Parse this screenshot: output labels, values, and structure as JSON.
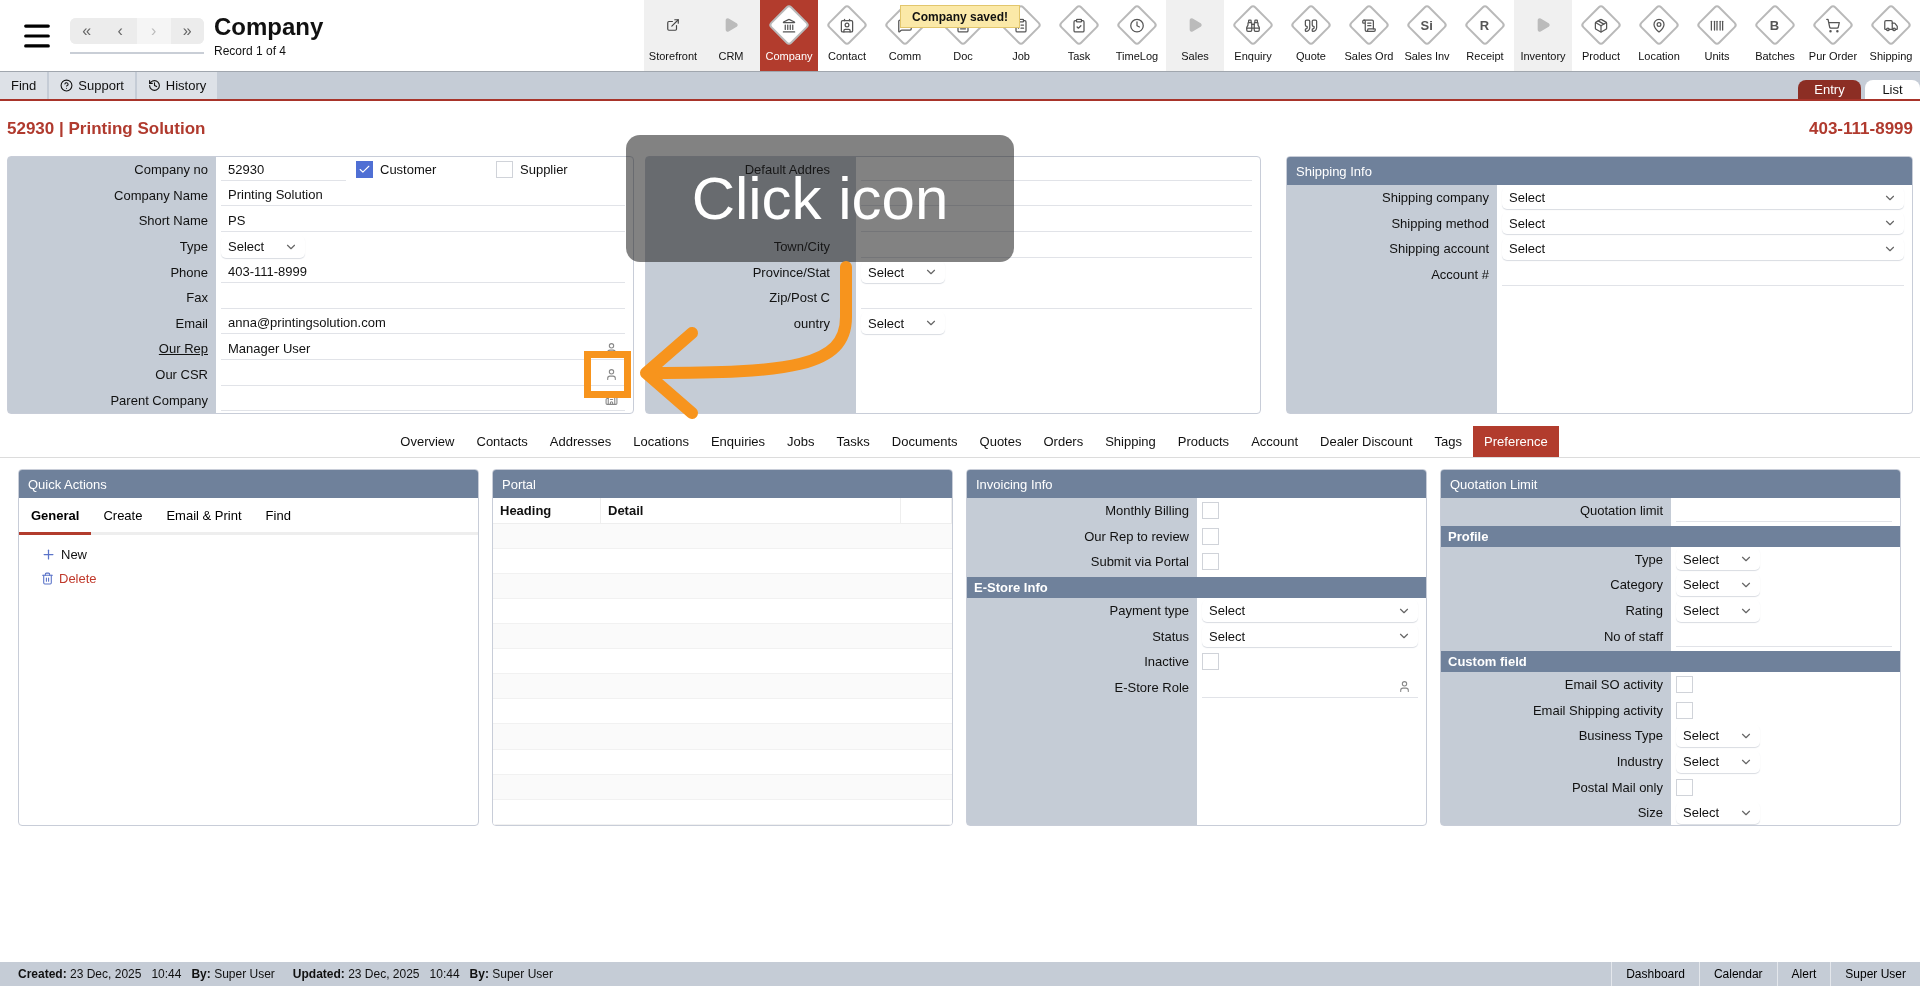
{
  "topbar": {
    "title": "Company",
    "record": "Record 1 of 4",
    "nav": [
      {
        "label": "«",
        "disabled": false
      },
      {
        "label": "‹",
        "disabled": false
      },
      {
        "label": "›",
        "disabled": true
      },
      {
        "label": "»",
        "disabled": false
      }
    ],
    "modules": [
      {
        "label": "Storefront",
        "kind": "link",
        "selected": false
      },
      {
        "label": "CRM",
        "kind": "group",
        "selected": false
      },
      {
        "label": "Company",
        "kind": "module",
        "selected": true
      },
      {
        "label": "Contact",
        "kind": "module",
        "selected": false
      },
      {
        "label": "Comm",
        "kind": "module",
        "selected": false
      },
      {
        "label": "Doc",
        "kind": "module",
        "selected": false
      },
      {
        "label": "Job",
        "kind": "module",
        "selected": false
      },
      {
        "label": "Task",
        "kind": "module",
        "selected": false
      },
      {
        "label": "TimeLog",
        "kind": "module",
        "selected": false
      },
      {
        "label": "Sales",
        "kind": "group",
        "selected": false
      },
      {
        "label": "Enquiry",
        "kind": "module",
        "selected": false
      },
      {
        "label": "Quote",
        "kind": "module",
        "selected": false
      },
      {
        "label": "Sales Ord",
        "kind": "module",
        "selected": false
      },
      {
        "label": "Sales Inv",
        "kind": "module",
        "selected": false,
        "glyph": "Si"
      },
      {
        "label": "Receipt",
        "kind": "module",
        "selected": false,
        "glyph": "R"
      },
      {
        "label": "Inventory",
        "kind": "group",
        "selected": false
      },
      {
        "label": "Product",
        "kind": "module",
        "selected": false
      },
      {
        "label": "Location",
        "kind": "module",
        "selected": false
      },
      {
        "label": "Units",
        "kind": "module",
        "selected": false
      },
      {
        "label": "Batches",
        "kind": "module",
        "selected": false,
        "glyph": "B"
      },
      {
        "label": "Pur Order",
        "kind": "module",
        "selected": false
      },
      {
        "label": "Shipping",
        "kind": "module",
        "selected": false
      }
    ]
  },
  "toast": "Company saved!",
  "toolbar": {
    "buttons": [
      {
        "label": "Find",
        "kind": "plain"
      },
      {
        "label": "Support",
        "kind": "help"
      },
      {
        "label": "History",
        "kind": "history"
      }
    ],
    "views": [
      {
        "label": "Entry",
        "selected": true
      },
      {
        "label": "List",
        "selected": false
      }
    ]
  },
  "record": {
    "heading": "52930 | Printing Solution",
    "phone": "403-111-8999"
  },
  "company_panel": {
    "rows": [
      {
        "label": "Company no",
        "kind": "text",
        "value": "52930",
        "flags": [
          {
            "label": "Customer",
            "checked": true
          },
          {
            "label": "Supplier",
            "checked": false
          }
        ]
      },
      {
        "label": "Company Name",
        "kind": "text",
        "value": "Printing Solution"
      },
      {
        "label": "Short Name",
        "kind": "text",
        "value": "PS"
      },
      {
        "label": "Type",
        "kind": "choice",
        "value": "Select"
      },
      {
        "label": "Phone",
        "kind": "text",
        "value": "403-111-8999"
      },
      {
        "label": "Fax",
        "kind": "text"
      },
      {
        "label": "Email",
        "kind": "text",
        "value": "anna@printingsolution.com"
      },
      {
        "label": "Our Rep",
        "kind": "lookup",
        "value": "Manager User",
        "link": true
      },
      {
        "label": "Our CSR",
        "kind": "lookup"
      },
      {
        "label": "Parent Company",
        "kind": "company"
      }
    ]
  },
  "address_panel": {
    "rows": [
      {
        "label": "Default Addres",
        "kind": "text"
      },
      {
        "kind": "text"
      },
      {
        "kind": "text"
      },
      {
        "label": "Town/City",
        "kind": "text"
      },
      {
        "label": "Province/Stat",
        "kind": "choice",
        "value": "Select"
      },
      {
        "label": "Zip/Post C",
        "kind": "text"
      },
      {
        "label": "ountry",
        "kind": "choice",
        "value": "Select"
      }
    ]
  },
  "shipping_panel": {
    "title": "Shipping Info",
    "rows": [
      {
        "label": "Shipping company",
        "kind": "select",
        "value": "Select"
      },
      {
        "label": "Shipping method",
        "kind": "select",
        "value": "Select"
      },
      {
        "label": "Shipping account",
        "kind": "select",
        "value": "Select"
      },
      {
        "label": "Account #",
        "kind": "text"
      }
    ]
  },
  "tabs": [
    {
      "label": "Overview",
      "selected": false
    },
    {
      "label": "Contacts",
      "selected": false
    },
    {
      "label": "Addresses",
      "selected": false
    },
    {
      "label": "Locations",
      "selected": false
    },
    {
      "label": "Enquiries",
      "selected": false
    },
    {
      "label": "Jobs",
      "selected": false
    },
    {
      "label": "Tasks",
      "selected": false
    },
    {
      "label": "Documents",
      "selected": false
    },
    {
      "label": "Quotes",
      "selected": false
    },
    {
      "label": "Orders",
      "selected": false
    },
    {
      "label": "Shipping",
      "selected": false
    },
    {
      "label": "Products",
      "selected": false
    },
    {
      "label": "Account",
      "selected": false
    },
    {
      "label": "Dealer Discount",
      "selected": false
    },
    {
      "label": "Tags",
      "selected": false
    },
    {
      "label": "Preference",
      "selected": true
    }
  ],
  "quick_actions": {
    "title": "Quick Actions",
    "tabs": [
      {
        "label": "General",
        "selected": true
      },
      {
        "label": "Create",
        "selected": false
      },
      {
        "label": "Email & Print",
        "selected": false
      },
      {
        "label": "Find",
        "selected": false
      }
    ],
    "actions": [
      {
        "label": "New",
        "kind": "add"
      },
      {
        "label": "Delete",
        "kind": "delete"
      }
    ]
  },
  "portal": {
    "title": "Portal",
    "columns": [
      "Heading",
      "Detail"
    ]
  },
  "invoicing": {
    "title": "Invoicing Info",
    "sections": [
      {
        "rows": [
          {
            "label": "Monthly Billing",
            "kind": "checkbox",
            "checked": false
          },
          {
            "label": "Our Rep to review",
            "kind": "checkbox",
            "checked": false
          },
          {
            "label": "Submit via Portal",
            "kind": "checkbox",
            "checked": false
          }
        ]
      },
      {
        "title": "E-Store Info",
        "rows": [
          {
            "label": "Payment type",
            "kind": "select",
            "value": "Select"
          },
          {
            "label": "Status",
            "kind": "select",
            "value": "Select"
          },
          {
            "label": "Inactive",
            "kind": "checkbox",
            "checked": false
          },
          {
            "label": "E-Store Role",
            "kind": "lookup"
          }
        ]
      }
    ]
  },
  "quotation": {
    "title": "Quotation Limit",
    "sections": [
      {
        "rows": [
          {
            "label": "Quotation limit",
            "kind": "text"
          }
        ]
      },
      {
        "title": "Profile",
        "rows": [
          {
            "label": "Type",
            "kind": "choice",
            "value": "Select"
          },
          {
            "label": "Category",
            "kind": "choice",
            "value": "Select"
          },
          {
            "label": "Rating",
            "kind": "choice",
            "value": "Select"
          },
          {
            "label": "No of staff",
            "kind": "text"
          }
        ]
      },
      {
        "title": "Custom field",
        "rows": [
          {
            "label": "Email SO activity",
            "kind": "checkbox",
            "checked": false
          },
          {
            "label": "Email Shipping activity",
            "kind": "checkbox",
            "checked": false
          },
          {
            "label": "Business Type",
            "kind": "choice",
            "value": "Select"
          },
          {
            "label": "Industry",
            "kind": "choice",
            "value": "Select"
          },
          {
            "label": "Postal Mail only",
            "kind": "checkbox",
            "checked": false
          },
          {
            "label": "Size",
            "kind": "choice",
            "value": "Select"
          }
        ]
      }
    ]
  },
  "footer": {
    "created": "**Created:** 23 Dec, 2025   10:44   **By:** Super User",
    "updated": "**Updated:** 23 Dec, 2025   10:44   **By:** Super User",
    "links": [
      "Dashboard",
      "Calendar",
      "Alert",
      "Super User"
    ]
  },
  "hint": {
    "text": "Click icon"
  }
}
